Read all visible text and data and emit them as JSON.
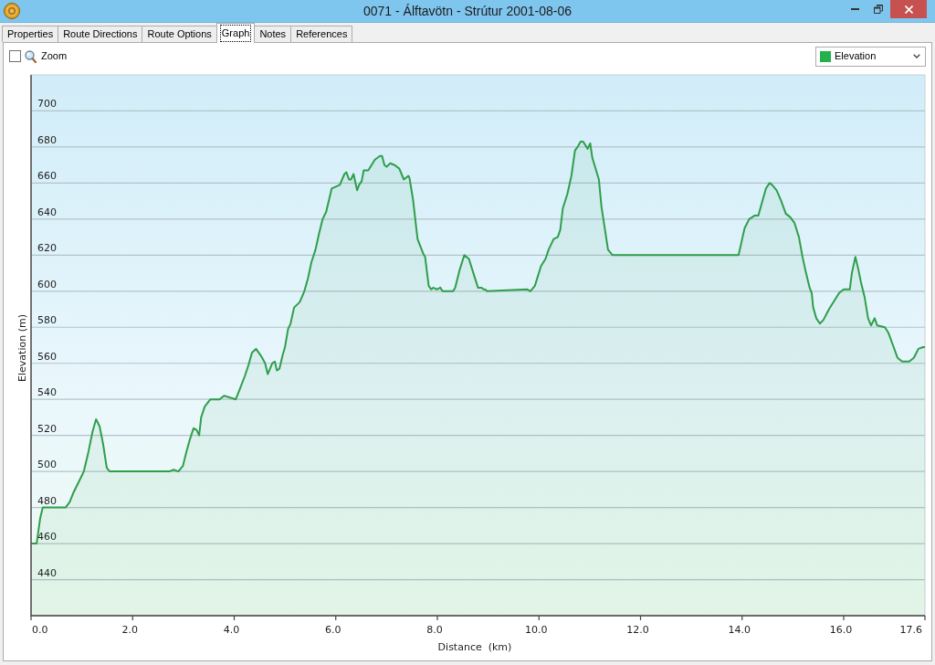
{
  "window": {
    "title": "0071 - Álftavötn - Strútur 2001-08-06"
  },
  "tabs": [
    {
      "label": "Properties",
      "selected": false
    },
    {
      "label": "Route Directions",
      "selected": false
    },
    {
      "label": "Route Options",
      "selected": false
    },
    {
      "label": "Graph",
      "selected": true
    },
    {
      "label": "Notes",
      "selected": false
    },
    {
      "label": "References",
      "selected": false
    }
  ],
  "toolbar": {
    "zoom": {
      "label": "Zoom",
      "checked": false
    },
    "series_select": {
      "value": "Elevation",
      "color": "#22b14c"
    }
  },
  "graph": {
    "chart_data": {
      "type": "area",
      "xlabel": "Distance  (km)",
      "ylabel": "Elevation (m)",
      "xlim": [
        0,
        17.6
      ],
      "ylim": [
        420,
        720
      ],
      "grid": true,
      "xticks": [
        {
          "value": 0,
          "label": "0.0"
        },
        {
          "value": 2,
          "label": "2.0"
        },
        {
          "value": 4,
          "label": "4.0"
        },
        {
          "value": 6,
          "label": "6.0"
        },
        {
          "value": 8,
          "label": "8.0"
        },
        {
          "value": 10,
          "label": "10.0"
        },
        {
          "value": 12,
          "label": "12.0"
        },
        {
          "value": 14,
          "label": "14.0"
        },
        {
          "value": 16,
          "label": "16.0"
        },
        {
          "value": 17.6,
          "label": "17.6"
        }
      ],
      "yticks": [
        440,
        460,
        480,
        500,
        520,
        540,
        560,
        580,
        600,
        620,
        640,
        660,
        680,
        700
      ],
      "x": [
        0,
        0.11,
        0.18,
        0.23,
        0.68,
        0.76,
        0.83,
        0.97,
        1.04,
        1.13,
        1.21,
        1.28,
        1.35,
        1.42,
        1.49,
        1.55,
        2.72,
        2.81,
        2.9,
        2.99,
        3.06,
        3.13,
        3.2,
        3.26,
        3.31,
        3.35,
        3.42,
        3.53,
        3.71,
        3.8,
        4.03,
        4.1,
        4.21,
        4.28,
        4.35,
        4.43,
        4.53,
        4.61,
        4.66,
        4.75,
        4.8,
        4.84,
        4.89,
        4.95,
        5.0,
        5.06,
        5.11,
        5.18,
        5.29,
        5.38,
        5.45,
        5.52,
        5.6,
        5.67,
        5.74,
        5.81,
        5.92,
        6.08,
        6.17,
        6.21,
        6.26,
        6.3,
        6.35,
        6.42,
        6.46,
        6.51,
        6.55,
        6.64,
        6.77,
        6.87,
        6.91,
        6.96,
        7.0,
        7.07,
        7.16,
        7.25,
        7.34,
        7.43,
        7.45,
        7.52,
        7.61,
        7.72,
        7.76,
        7.83,
        7.88,
        7.92,
        7.99,
        8.06,
        8.1,
        8.31,
        8.35,
        8.44,
        8.53,
        8.62,
        8.71,
        8.8,
        8.87,
        8.91,
        8.94,
        8.98,
        9.77,
        9.83,
        9.92,
        10.04,
        10.13,
        10.19,
        10.29,
        10.37,
        10.42,
        10.47,
        10.56,
        10.64,
        10.71,
        10.76,
        10.82,
        10.87,
        10.96,
        11.01,
        11.05,
        11.18,
        11.23,
        11.3,
        11.36,
        11.45,
        13.93,
        14.0,
        14.05,
        14.14,
        14.25,
        14.32,
        14.4,
        14.47,
        14.54,
        14.59,
        14.68,
        14.77,
        14.86,
        14.95,
        15.03,
        15.12,
        15.19,
        15.26,
        15.33,
        15.37,
        15.4,
        15.46,
        15.53,
        15.6,
        15.71,
        15.82,
        15.91,
        16.0,
        16.12,
        16.16,
        16.23,
        16.29,
        16.34,
        16.41,
        16.48,
        16.54,
        16.61,
        16.66,
        16.81,
        16.88,
        16.97,
        17.06,
        17.15,
        17.29,
        17.38,
        17.47,
        17.56,
        17.6
      ],
      "series": [
        {
          "color": "#2f9e4b",
          "values": [
            460,
            460,
            474,
            480,
            480,
            483,
            488,
            496,
            500,
            511,
            522,
            529,
            525,
            515,
            502,
            500,
            500,
            501,
            500,
            503,
            511,
            518,
            524,
            523,
            520,
            530,
            536,
            540,
            540,
            542,
            540,
            545,
            553,
            559,
            566,
            568,
            564,
            560,
            554,
            560,
            561,
            556,
            557,
            564,
            569,
            579,
            582,
            591,
            594,
            600,
            607,
            616,
            623,
            632,
            640,
            644,
            657,
            659,
            665,
            666,
            662,
            662,
            665,
            656,
            659,
            661,
            667,
            667,
            673,
            675,
            675,
            670,
            669,
            671,
            670,
            668,
            662,
            664,
            663,
            651,
            629,
            621,
            619,
            603,
            601,
            602,
            601,
            602,
            600,
            600,
            602,
            612,
            620,
            618,
            610,
            602,
            602,
            601,
            601,
            600,
            601,
            600,
            603,
            614,
            618,
            623,
            629,
            630,
            634,
            646,
            654,
            664,
            678,
            680,
            683,
            683,
            679,
            682,
            674,
            662,
            647,
            634,
            623,
            620,
            620,
            629,
            635,
            640,
            642,
            642,
            650,
            657,
            660,
            659,
            656,
            650,
            643,
            641,
            638,
            630,
            619,
            610,
            602,
            599,
            591,
            585,
            582,
            584,
            590,
            595,
            599,
            601,
            601,
            610,
            619,
            612,
            605,
            597,
            585,
            581,
            585,
            581,
            580,
            577,
            570,
            563,
            561,
            561,
            563,
            568,
            569,
            569
          ]
        }
      ]
    }
  }
}
